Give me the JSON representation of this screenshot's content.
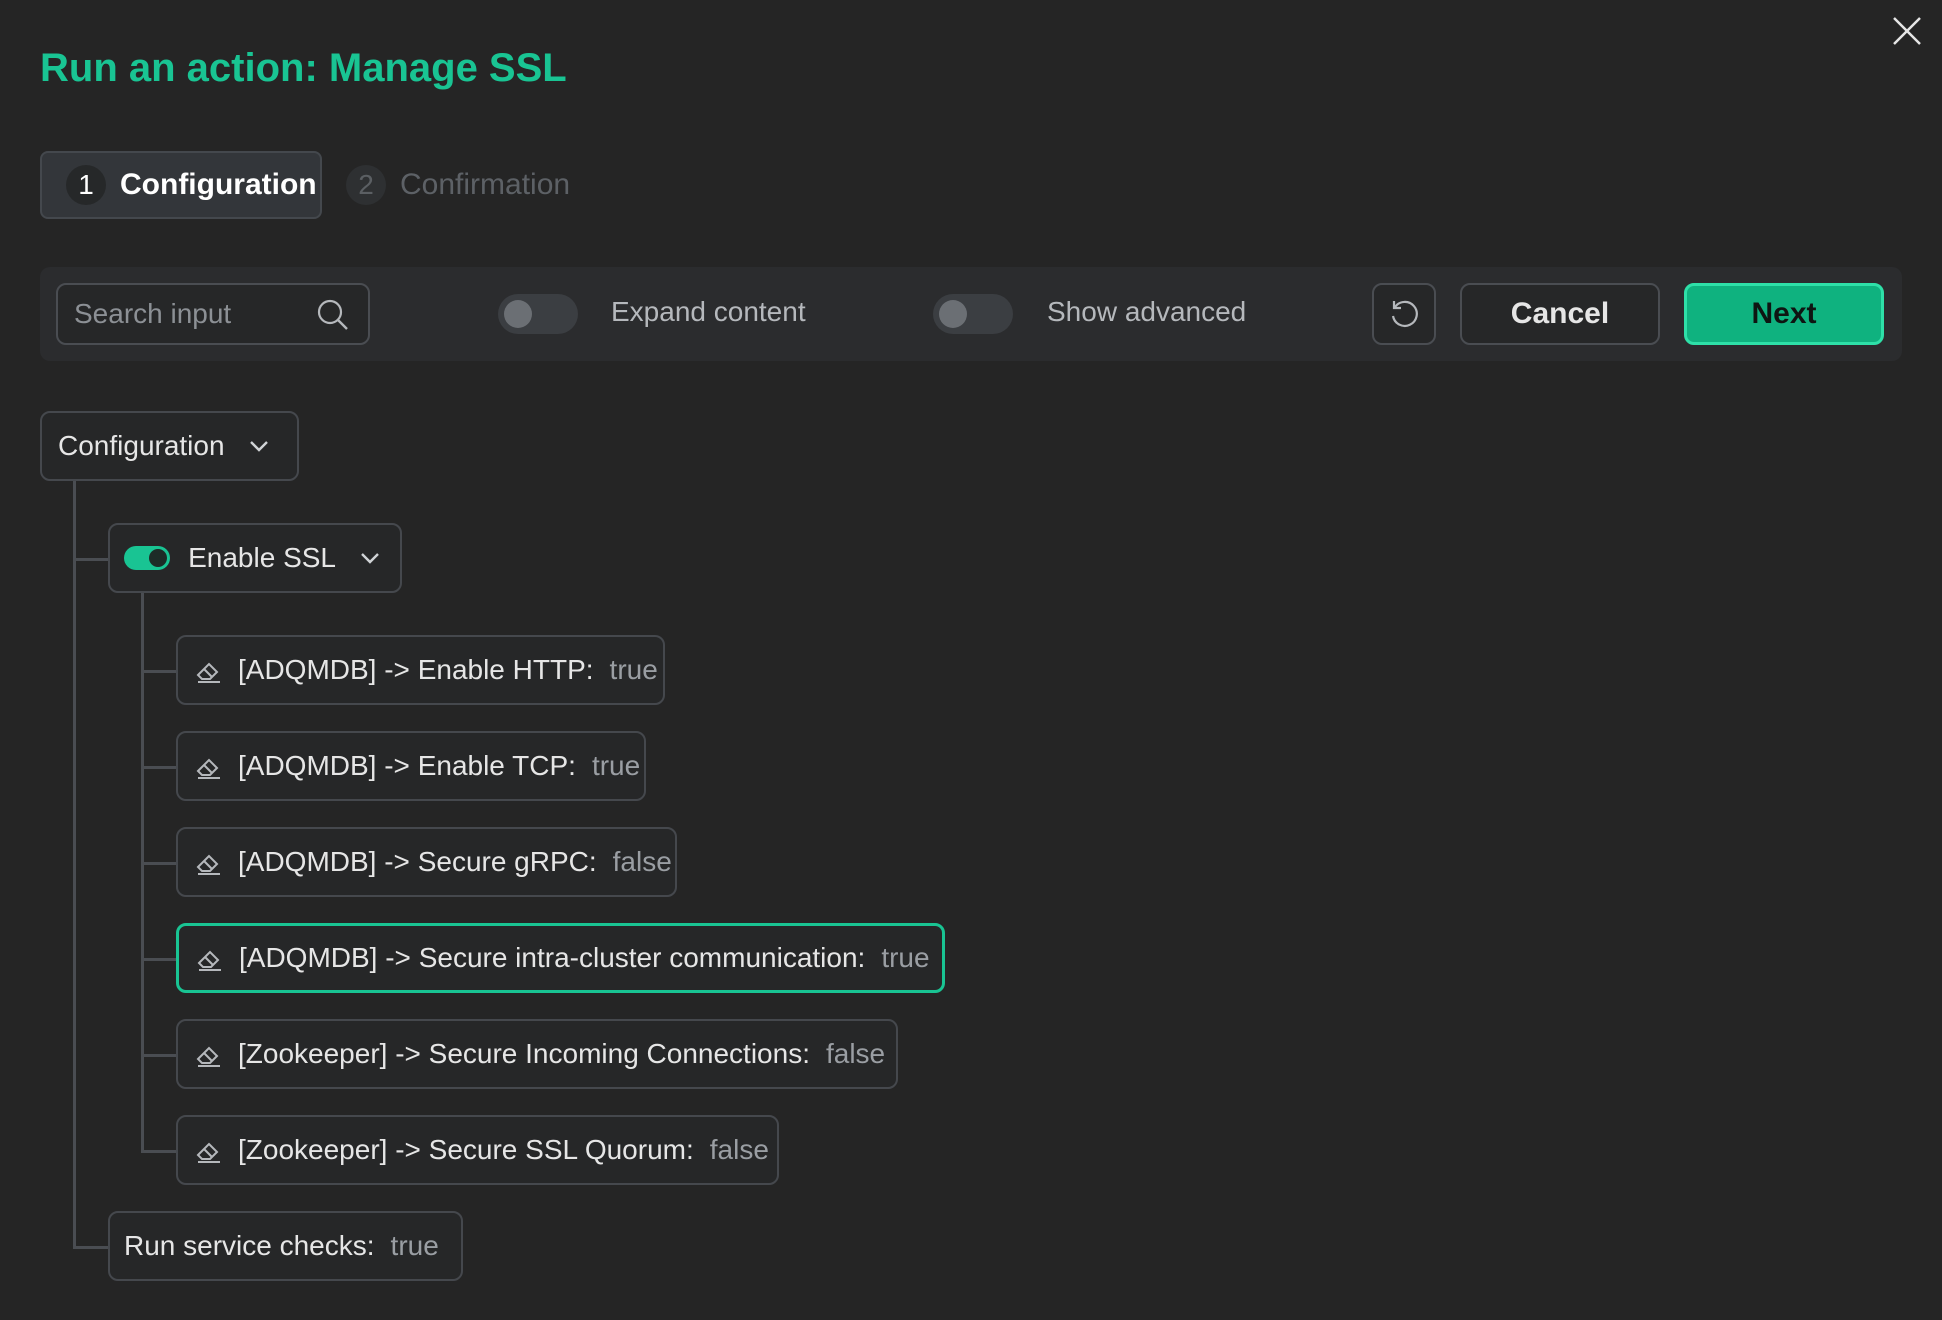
{
  "dialog": {
    "title": "Run an action: Manage SSL"
  },
  "stepper": {
    "steps": [
      {
        "number": "1",
        "label": "Configuration",
        "active": true
      },
      {
        "number": "2",
        "label": "Confirmation",
        "active": false
      }
    ]
  },
  "toolbar": {
    "search_placeholder": "Search input",
    "search_value": "",
    "expand_content_label": "Expand content",
    "expand_content_on": false,
    "show_advanced_label": "Show advanced",
    "show_advanced_on": false,
    "cancel_label": "Cancel",
    "next_label": "Next"
  },
  "tree": {
    "root_label": "Configuration",
    "group": {
      "label": "Enable SSL",
      "enabled": true,
      "fields": [
        {
          "label": "[ADQMDB] -> Enable HTTP:",
          "value": "true"
        },
        {
          "label": "[ADQMDB] -> Enable TCP:",
          "value": "true"
        },
        {
          "label": "[ADQMDB] -> Secure gRPC:",
          "value": "false"
        },
        {
          "label": "[ADQMDB] -> Secure intra-cluster communication:",
          "value": "true"
        },
        {
          "label": "[Zookeeper] -> Secure Incoming Connections:",
          "value": "false"
        },
        {
          "label": "[Zookeeper] -> Secure SSL Quorum:",
          "value": "false"
        }
      ]
    },
    "run_checks": {
      "label": "Run service checks:",
      "value": "true"
    }
  },
  "colors": {
    "accent": "#19c493",
    "background": "#252525",
    "next_button": "#0fb27f"
  },
  "icons": [
    "close-icon",
    "search-icon",
    "reset-icon",
    "chevron-down-icon",
    "eraser-icon"
  ]
}
